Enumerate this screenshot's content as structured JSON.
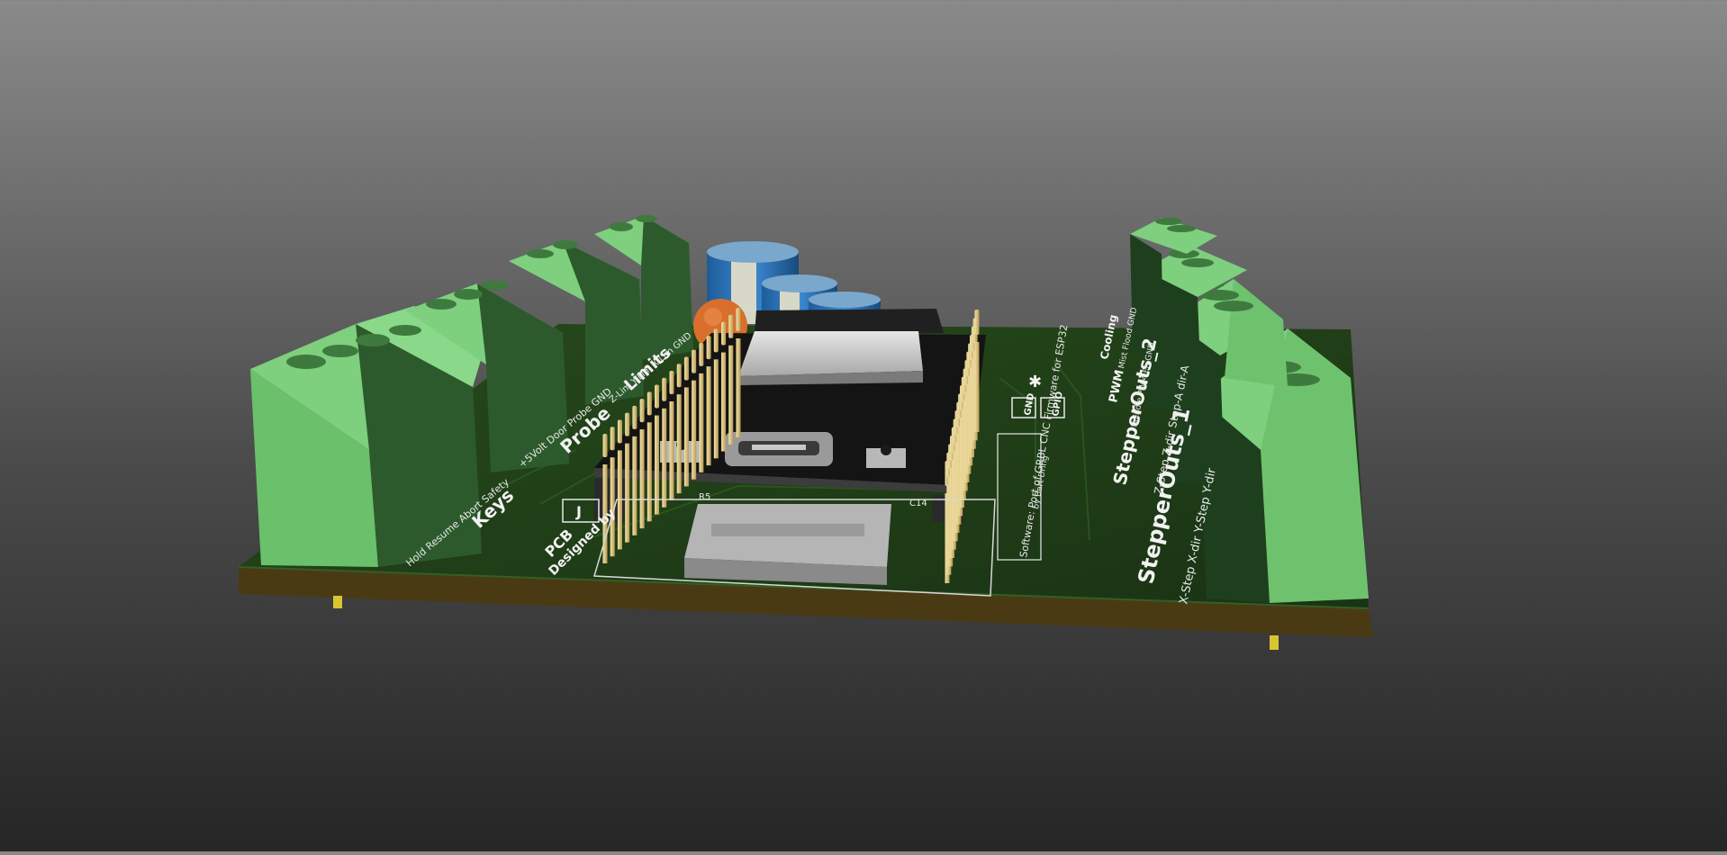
{
  "colors": {
    "board": "#1f3d17",
    "board_edge": "#4a3a14",
    "terminal_light": "#7ecf7e",
    "terminal_dark": "#2d5a2d",
    "module": "#141414",
    "pins": "#e0c680",
    "capacitor": "#2a72b8",
    "silkscreen": "#f2f2f2"
  },
  "silkscreen": {
    "keys_title": "Keys",
    "keys_pins": "Hold Resume Abort Safety",
    "probe_title": "Probe",
    "probe_pins": "+5Volt Door Probe GND",
    "limits_title": "Limits",
    "limits_pins": "Z-Lim Y-Lim X-Lim GND",
    "pcb_credit_1": "PCB",
    "pcb_credit_2": "Designed by",
    "stepper1_title": "StepperOuts_1",
    "stepper1_pins": "X-Step X-dir Y-Step Y-dir",
    "stepper2_title": "StepperOuts_2",
    "stepper2_pins": "Z-Step Z-dir Step-A dir-A",
    "pwm_title": "PWM",
    "pwm_pins": "Spindle PWM En GND",
    "coolant_title": "Cooling",
    "coolant_pins": "Mist Flood GND",
    "gnd_label": "GND",
    "gpio_label": "GPIO",
    "software_line1": "Software: Port of GRBL CNC Firmware for ESP32",
    "software_line2": "by Bart Dring",
    "ref_c14": "C14",
    "ref_r": "R5",
    "logo_text": "J"
  }
}
